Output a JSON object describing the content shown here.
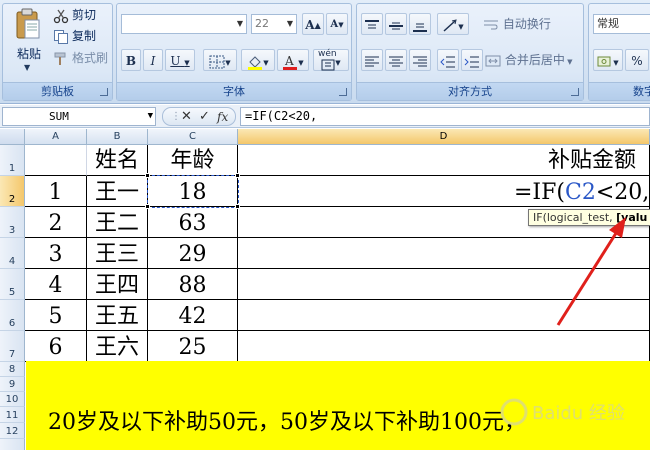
{
  "ribbon": {
    "clipboard": {
      "label": "剪贴板",
      "paste": "粘贴",
      "cut": "剪切",
      "copy": "复制",
      "format_painter": "格式刷"
    },
    "font": {
      "label": "字体",
      "font_name": "",
      "font_size": "22",
      "grow": "A",
      "shrink": "A",
      "bold": "B",
      "italic": "I",
      "underline": "U",
      "phonetic": "wén"
    },
    "alignment": {
      "label": "对齐方式",
      "wrap_text": "自动换行",
      "merge_center": "合并后居中"
    },
    "number": {
      "label": "数字",
      "format": "常规",
      "percent": "%"
    }
  },
  "formula_bar": {
    "name_box": "SUM",
    "cancel": "✕",
    "enter": "✓",
    "fx": "fx",
    "formula": "=IF(C2<20,"
  },
  "sheet": {
    "columns": [
      "A",
      "B",
      "C",
      "D"
    ],
    "rows": [
      "1",
      "2",
      "3",
      "4",
      "5",
      "6",
      "7",
      "8",
      "9",
      "10",
      "11",
      "12"
    ],
    "headers": {
      "name": "姓名",
      "age": "年龄",
      "subsidy": "补贴金额"
    },
    "records": [
      {
        "index": "1",
        "name": "王一",
        "age": "18"
      },
      {
        "index": "2",
        "name": "王二",
        "age": "63"
      },
      {
        "index": "3",
        "name": "王三",
        "age": "29"
      },
      {
        "index": "4",
        "name": "王四",
        "age": "88"
      },
      {
        "index": "5",
        "name": "王五",
        "age": "42"
      },
      {
        "index": "6",
        "name": "王六",
        "age": "25"
      }
    ],
    "edit_cell": {
      "prefix": "=IF(",
      "ref": "C2",
      "suffix": "<20,"
    },
    "tooltip": {
      "fn": "IF(logical_test, ",
      "arg": "[valu"
    },
    "note": "20岁及以下补助50元，50岁及以下补助100元，",
    "watermark": "Baidu 经验"
  },
  "colors": {
    "note_background": "#ffff00",
    "reference_blue": "#2a57c7",
    "annotation_arrow": "#e0201b"
  }
}
